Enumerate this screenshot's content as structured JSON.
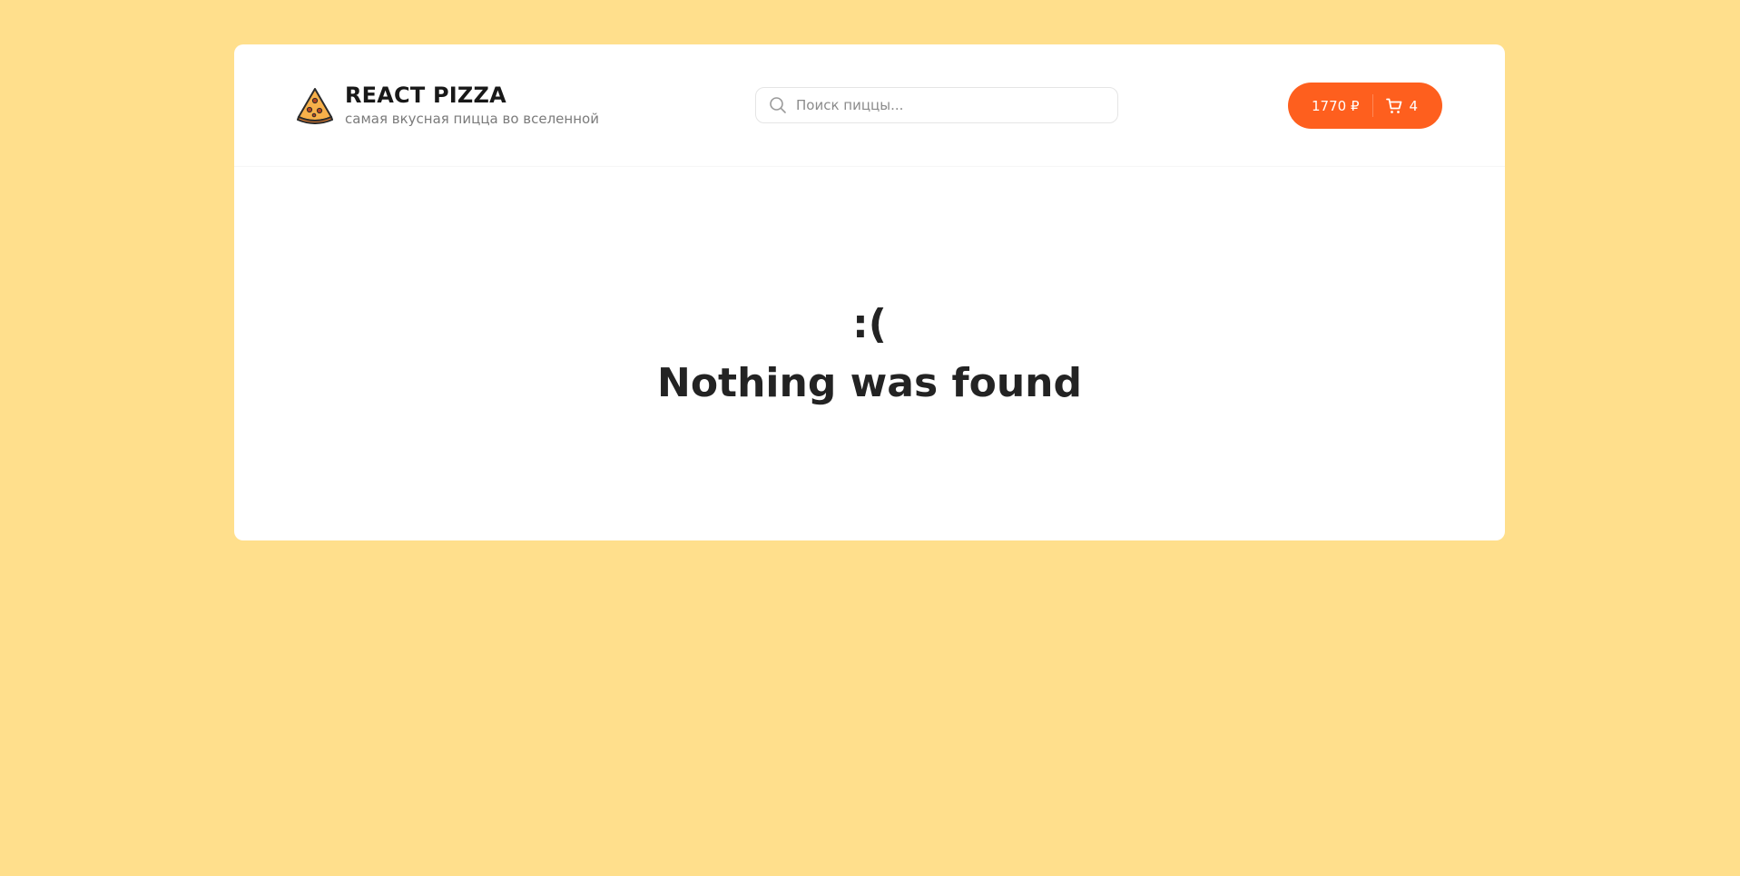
{
  "header": {
    "logo": {
      "icon": "pizza-slice-icon",
      "title": "REACT PIZZA",
      "subtitle": "самая вкусная пицца во вселенной"
    },
    "search": {
      "icon": "search-icon",
      "value": "",
      "placeholder": "Поиск пиццы..."
    },
    "cart": {
      "price": "1770 ₽",
      "icon": "cart-icon",
      "count": "4",
      "color": "#fe5f1e"
    }
  },
  "main": {
    "empty_face": ":(",
    "empty_title": "Nothing was found"
  },
  "colors": {
    "background": "#ffdf8c",
    "accent": "#fe5f1e",
    "card": "#ffffff"
  }
}
